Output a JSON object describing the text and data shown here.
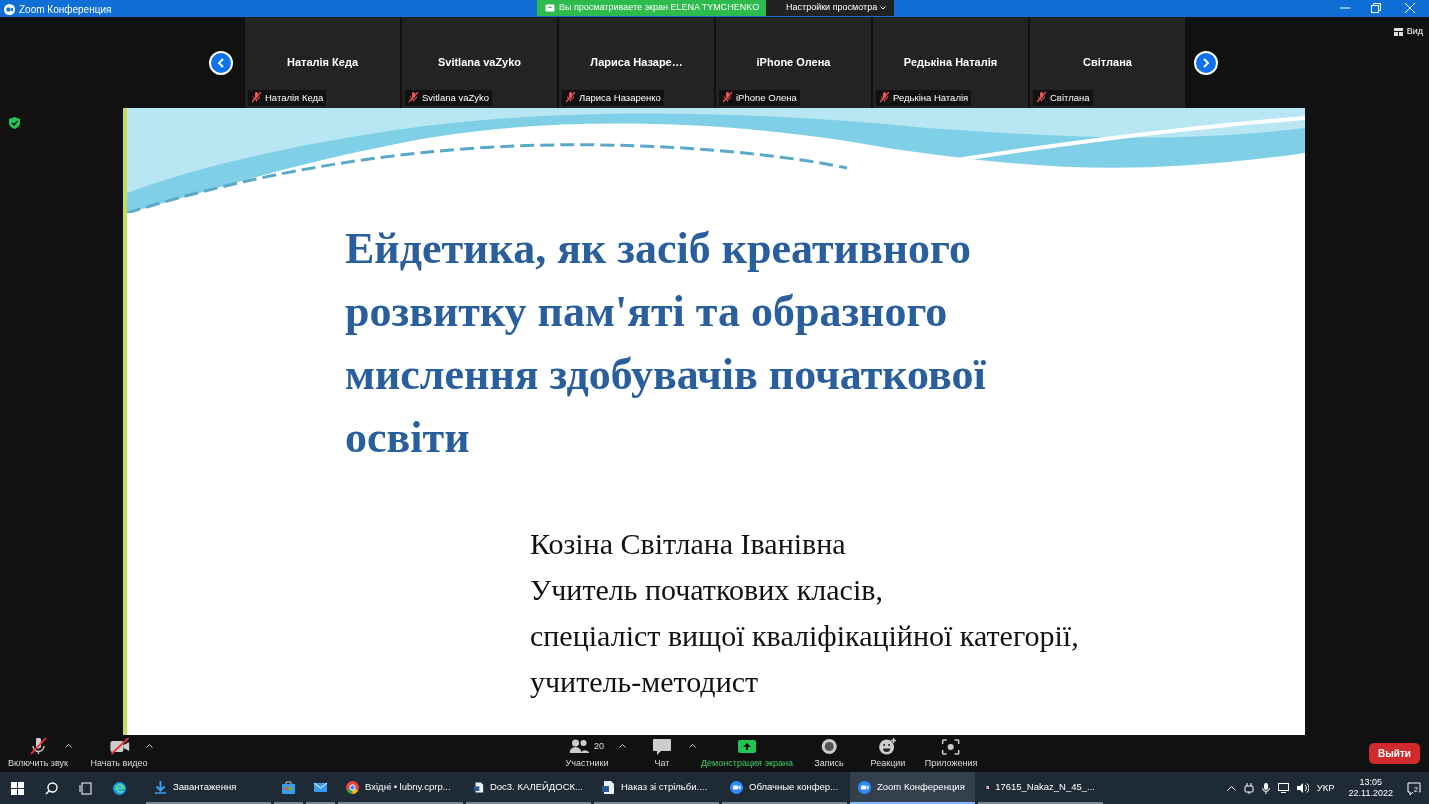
{
  "window": {
    "title": "Zoom Конференция"
  },
  "share_banner": {
    "text": "Вы просматриваете экран ELENA TYMCHENKO"
  },
  "view_settings": {
    "label": "Настройки просмотра"
  },
  "view_button": {
    "label": "Вид"
  },
  "participants": [
    {
      "tile_name": "Наталія Кеда",
      "label": "Наталія Кеда",
      "muted": true
    },
    {
      "tile_name": "Svitlana vaZyko",
      "label": "Svitlana vaZyko",
      "muted": true
    },
    {
      "tile_name": "Лариса  Назаре…",
      "label": "Лариса Назаренко",
      "muted": true
    },
    {
      "tile_name": "iPhone Олена",
      "label": "iPhone Олена",
      "muted": true
    },
    {
      "tile_name": "Редькіна Наталія",
      "label": "Редькіна Наталія",
      "muted": true
    },
    {
      "tile_name": "Світлана",
      "label": "Світлана",
      "muted": true
    }
  ],
  "slide": {
    "title_lines": [
      "Ейдетика, як засіб креативного",
      "розвитку пам'яті та образного",
      "мислення здобувачів початкової",
      "освіти"
    ],
    "author_lines": [
      "Козіна Світлана Іванівна",
      "Учитель початкових класів,",
      "спеціаліст вищої кваліфікаційної категорії,",
      "учитель-методист"
    ]
  },
  "toolbar": [
    {
      "kind": "audio",
      "label": "Включить звук",
      "caret": true
    },
    {
      "kind": "video",
      "label": "Начать видео",
      "caret": true
    },
    {
      "kind": "participants",
      "label": "Участники",
      "count": "20",
      "caret": true
    },
    {
      "kind": "chat",
      "label": "Чат",
      "caret": true
    },
    {
      "kind": "share",
      "label": "Демонстрация экрана",
      "caret": false
    },
    {
      "kind": "record",
      "label": "Запись",
      "caret": false
    },
    {
      "kind": "reactions",
      "label": "Реакции",
      "caret": false
    },
    {
      "kind": "apps",
      "label": "Приложения",
      "caret": false
    }
  ],
  "leave_button": {
    "label": "Выйти"
  },
  "taskbar": {
    "apps": [
      {
        "kind": "download",
        "label": "Завантаження",
        "selected": false
      },
      {
        "kind": "store",
        "selected": false
      },
      {
        "kind": "mail",
        "selected": false
      },
      {
        "kind": "chrome",
        "label": "Вхідні • lubny.cprp...",
        "selected": false
      },
      {
        "kind": "doc",
        "label": "Doc3. КАЛЕЙДОСК...",
        "selected": false
      },
      {
        "kind": "doc",
        "label": "Наказ зі стрільби....",
        "selected": false
      },
      {
        "kind": "zoom",
        "label": "Облачные конфер...",
        "selected": false
      },
      {
        "kind": "zoom",
        "label": "Zoom Конференция",
        "selected": true
      },
      {
        "kind": "pdf",
        "label": "17615_Nakaz_N_45_...",
        "selected": false
      }
    ],
    "language": "УКР",
    "time": "13:05",
    "date": "22.11.2022",
    "notifications": "2"
  }
}
